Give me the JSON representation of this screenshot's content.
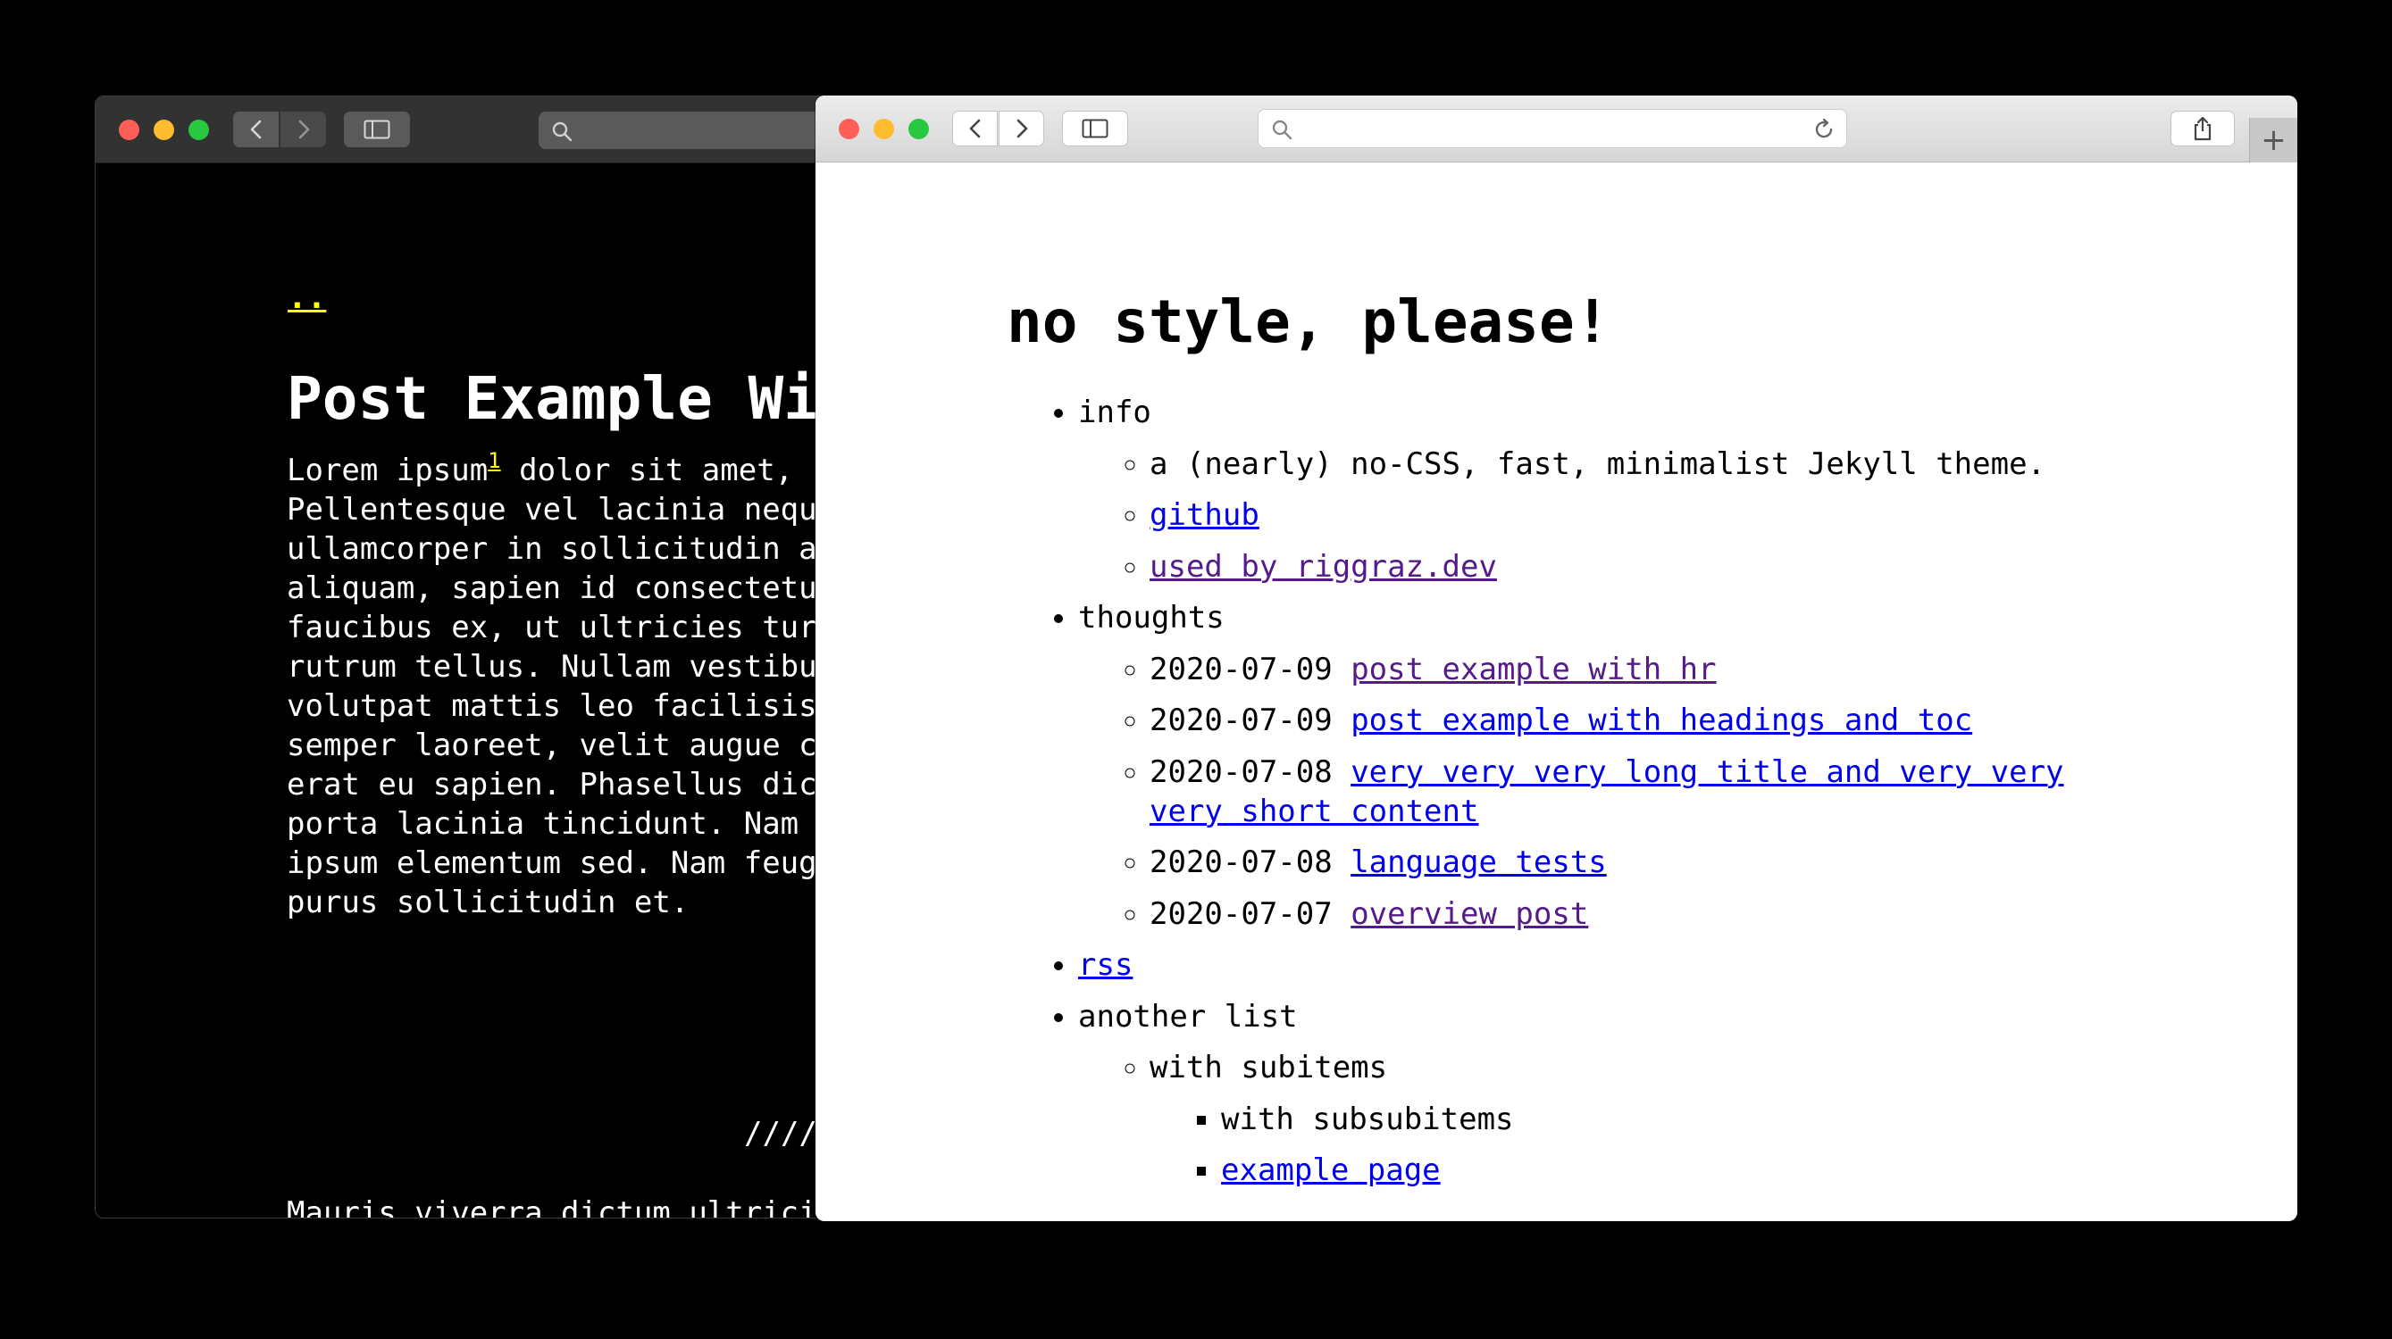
{
  "back_window": {
    "traffic_lights": {
      "close": "#ff5f57",
      "minimize": "#febc2e",
      "zoom": "#28c840"
    },
    "page": {
      "parent_link": "..",
      "title": "Post Example Wi",
      "paragraph1_start": "Lorem ipsum",
      "footnote_ref": "1",
      "paragraph1_rest": " dolor sit amet,\nPellentesque vel lacinia nequ\nullamcorper in sollicitudin a\naliquam, sapien id consectetu\nfaucibus ex, ut ultricies tur\nrutrum tellus. Nullam vestibu\nvolutpat mattis leo facilisis\nsemper laoreet, velit augue c\nerat eu sapien. Phasellus dic\nporta lacinia tincidunt. Nam \nipsum elementum sed. Nam feug\npurus sollicitudin et.",
      "separator": "////",
      "paragraph2": "Mauris viverra dictum ultrici\neuismod, facilisis metus sed,\nscelerisque lacus libero, eu "
    },
    "colors": {
      "background": "#000000",
      "text": "#ffffff",
      "link": "#ffff00"
    }
  },
  "front_window": {
    "traffic_lights": {
      "close": "#ff5f57",
      "minimize": "#febc2e",
      "zoom": "#28c840"
    },
    "new_tab_label": "+",
    "page": {
      "title": "no style, please!",
      "info": {
        "label": "info",
        "items": {
          "description": "a (nearly) no-CSS, fast, minimalist Jekyll theme.",
          "github": "github",
          "used_by": "used by riggraz.dev"
        }
      },
      "thoughts": {
        "label": "thoughts",
        "posts": [
          {
            "date": "2020-07-09",
            "title": "post example with hr"
          },
          {
            "date": "2020-07-09",
            "title": "post example with headings and toc"
          },
          {
            "date": "2020-07-08",
            "title": "very very very long title and very very very short content"
          },
          {
            "date": "2020-07-08",
            "title": "language tests"
          },
          {
            "date": "2020-07-07",
            "title": "overview post"
          }
        ]
      },
      "rss": "rss",
      "another_list": {
        "label": "another list",
        "subitem": "with subitems",
        "subsubitems": [
          "with subsubitems",
          "example page"
        ]
      }
    },
    "colors": {
      "link": "#0000ee",
      "visited_link": "#551a8b",
      "text": "#000000"
    }
  }
}
